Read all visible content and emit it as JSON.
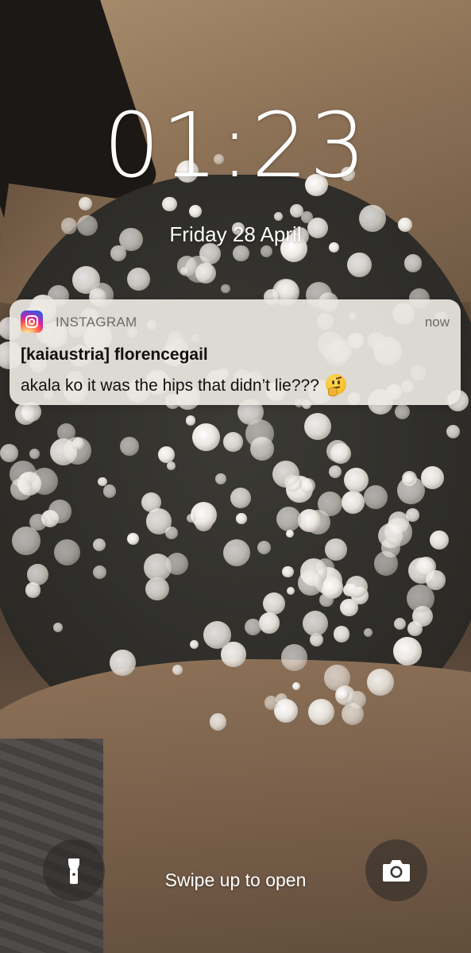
{
  "lock_screen": {
    "time": "01:23",
    "date": "Friday 28 April"
  },
  "notification": {
    "app_icon": "instagram-icon",
    "app_name": "INSTAGRAM",
    "timestamp": "now",
    "title": "[kaiaustria] florencegail",
    "body": "akala ko it was the hips that didn’t lie???",
    "emoji": "thinking-face-emoji"
  },
  "bottom_bar": {
    "flashlight_icon": "flashlight-icon",
    "camera_icon": "camera-icon",
    "swipe_hint": "Swipe up to open"
  }
}
